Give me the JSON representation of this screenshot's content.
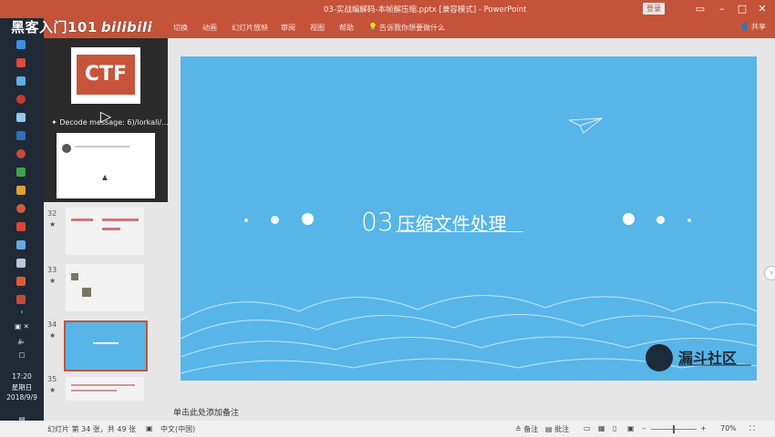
{
  "window": {
    "title": "03-实战编解码-本帧解压缩.pptx [兼容模式] - PowerPoint",
    "login_label": "登录"
  },
  "ribbon": {
    "tabs": [
      "切换",
      "动画",
      "幻灯片放映",
      "审阅",
      "视图",
      "帮助",
      "告诉我你想要做什么"
    ],
    "share_label": "共享"
  },
  "watermark": {
    "text": "黑客入门101",
    "brand": "bilibili"
  },
  "video_panel": {
    "ctf_label": "CTF",
    "caption": "Decode message: 6)/lorkali/..."
  },
  "thumbnails": [
    {
      "number": "32"
    },
    {
      "number": "33"
    },
    {
      "number": "34",
      "selected": true
    },
    {
      "number": "35"
    }
  ],
  "slide": {
    "number_text": "03",
    "title": "压缩文件处理",
    "logo_text": "漏斗社区"
  },
  "notes": {
    "placeholder": "单击此处添加备注"
  },
  "statusbar": {
    "slide_info": "幻灯片 第 34 张，共 49 张",
    "language": "中文(中国)",
    "notes_label": "备注",
    "comments_label": "批注",
    "zoom": "70%"
  },
  "taskbar": {
    "time": "17:20",
    "weekday": "星期日",
    "date": "2018/9/9"
  },
  "colors": {
    "accent": "#c4533a",
    "slide_bg": "#58b5e8",
    "taskbar": "#1f2a36"
  }
}
